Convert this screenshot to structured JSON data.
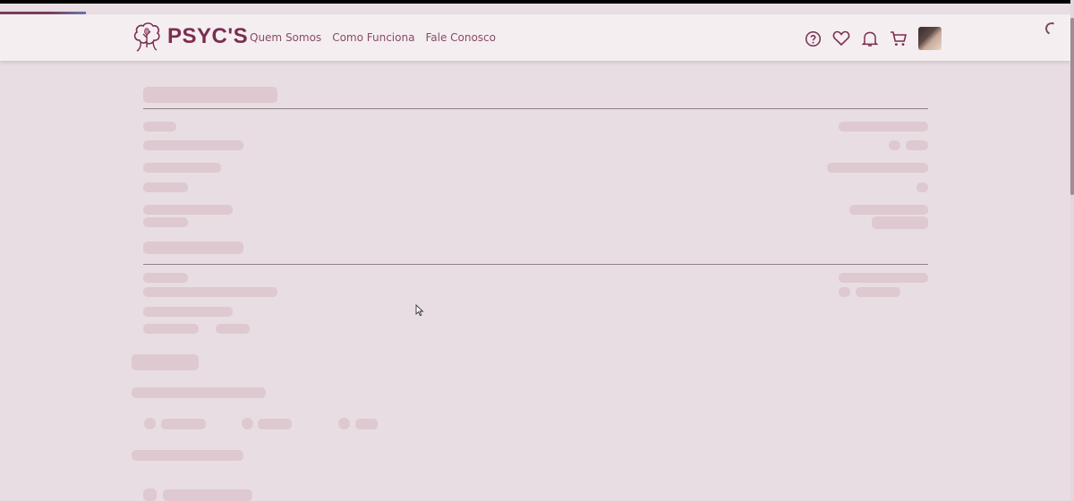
{
  "header": {
    "brand": "PSYC'S",
    "nav": [
      "Quem Somos",
      "Como Funciona",
      "Fale Conosco"
    ],
    "icons": [
      "help-icon",
      "heart-icon",
      "bell-icon",
      "cart-icon"
    ]
  },
  "state": {
    "loading": true
  },
  "colors": {
    "brand": "#7b2e4f",
    "nav_text": "#8a4a66",
    "background": "#e8dde3",
    "header_bg": "#f4eef1",
    "skeleton": "#ddc9cf"
  }
}
